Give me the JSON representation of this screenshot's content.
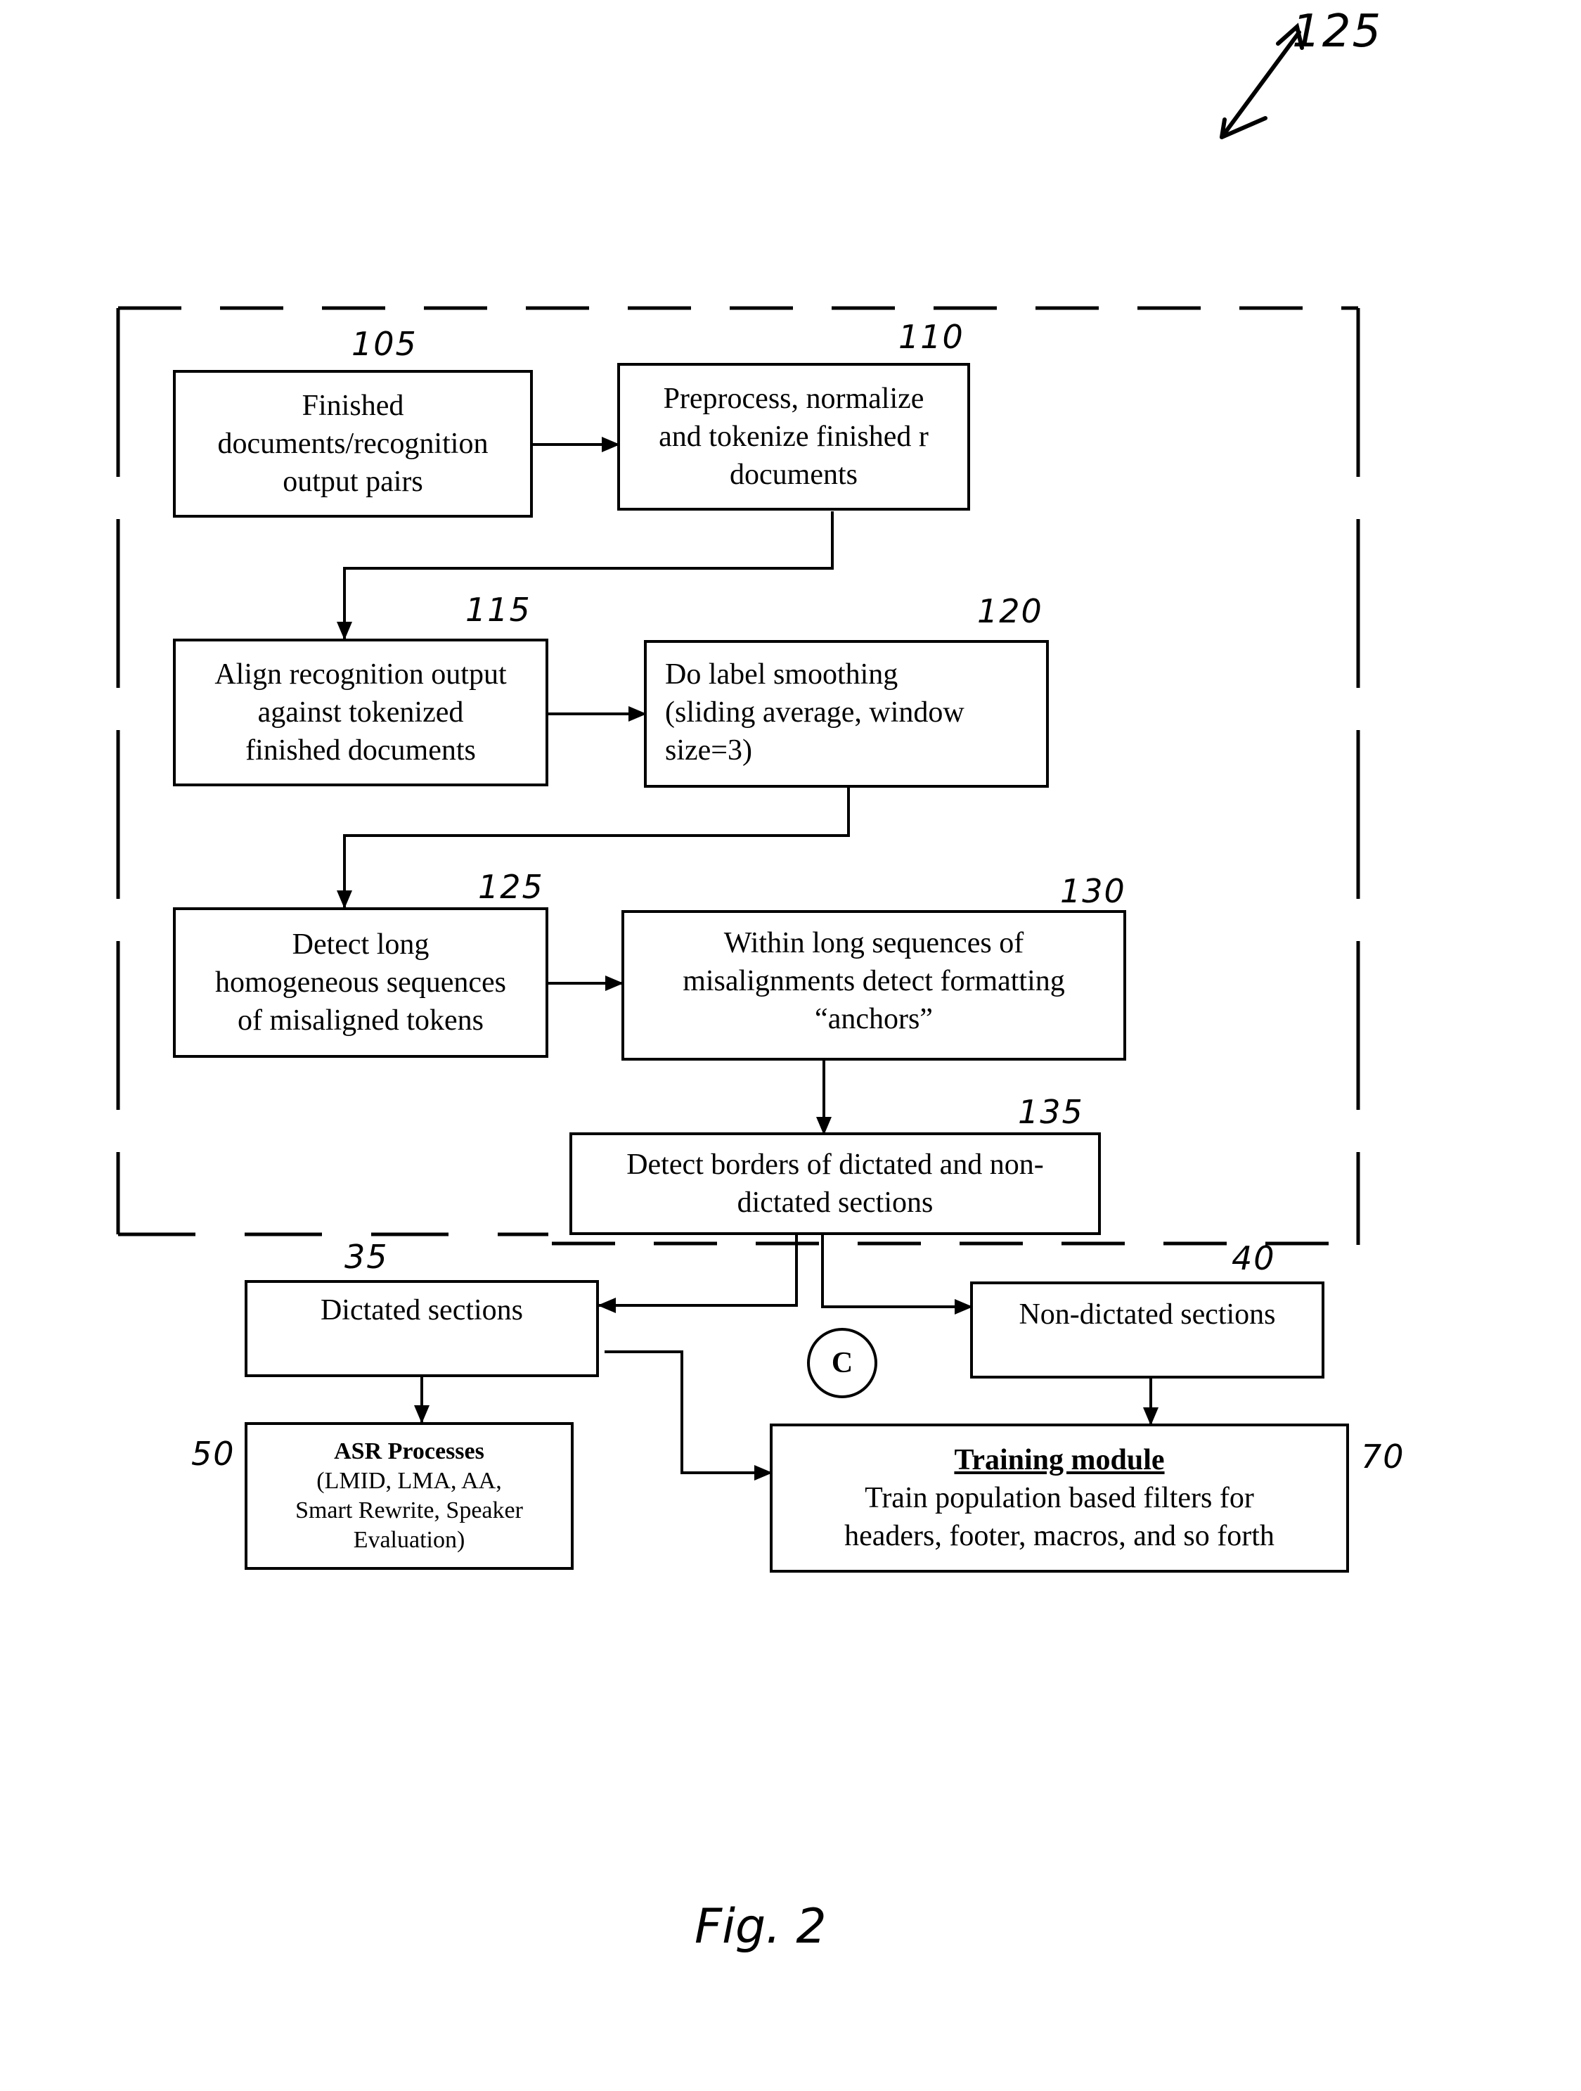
{
  "figure": {
    "caption": "Fig. 2",
    "reference_numeral": "125",
    "group_border": "dashed"
  },
  "steps": [
    {
      "id": "105",
      "ref": "105",
      "lines": [
        "Finished",
        "documents/recognition",
        "output pairs"
      ]
    },
    {
      "id": "110",
      "ref": "110",
      "lines": [
        "Preprocess, normalize",
        "and tokenize finished r",
        "documents"
      ]
    },
    {
      "id": "115",
      "ref": "115",
      "lines": [
        "Align recognition output",
        "against tokenized",
        "finished documents"
      ]
    },
    {
      "id": "120",
      "ref": "120",
      "lines": [
        "Do label smoothing",
        "(sliding average, window",
        "size=3)"
      ]
    },
    {
      "id": "125",
      "ref": "125",
      "lines": [
        "Detect long",
        "homogeneous sequences",
        "of misaligned tokens"
      ]
    },
    {
      "id": "130",
      "ref": "130",
      "lines": [
        "Within long sequences of",
        "misalignments detect formatting",
        "“anchors”"
      ]
    },
    {
      "id": "135",
      "ref": "135",
      "lines": [
        "Detect borders of dictated and non-",
        "dictated sections"
      ]
    },
    {
      "id": "35",
      "ref": "35",
      "lines": [
        "Dictated sections"
      ]
    },
    {
      "id": "40",
      "ref": "40",
      "lines": [
        "Non-dictated sections"
      ]
    },
    {
      "id": "50",
      "ref": "50",
      "title": "ASR Processes",
      "lines": [
        "(LMID, LMA, AA,",
        "Smart Rewrite, Speaker",
        "Evaluation)"
      ]
    },
    {
      "id": "70",
      "ref": "70",
      "title": "Training module",
      "lines": [
        "Train population based filters for",
        "headers, footer, macros, and so forth"
      ]
    }
  ],
  "connector": {
    "label": "C"
  },
  "edges": [
    {
      "from": "105",
      "to": "110"
    },
    {
      "from": "110",
      "to": "115"
    },
    {
      "from": "115",
      "to": "120"
    },
    {
      "from": "120",
      "to": "125"
    },
    {
      "from": "125",
      "to": "130"
    },
    {
      "from": "130",
      "to": "135"
    },
    {
      "from": "135",
      "to": "35"
    },
    {
      "from": "135",
      "to": "40"
    },
    {
      "from": "35",
      "to": "50"
    },
    {
      "from": "35",
      "to": "70"
    },
    {
      "from": "40",
      "to": "70"
    }
  ]
}
